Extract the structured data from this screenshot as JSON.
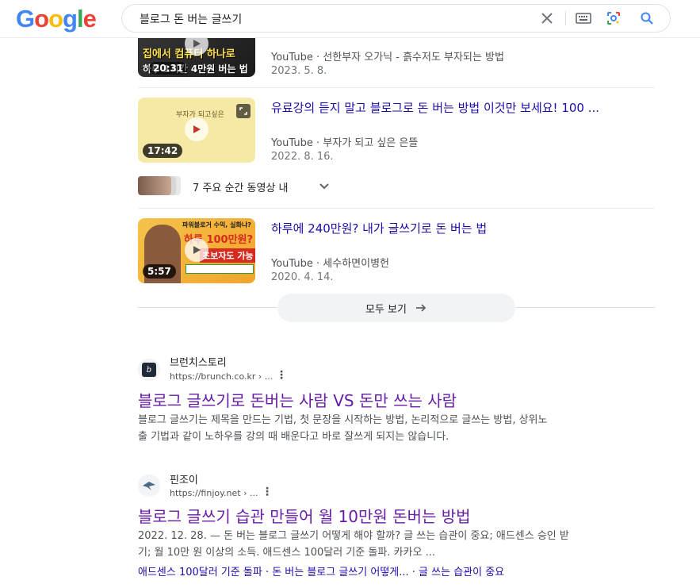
{
  "header": {
    "query": "블로그 돈 버는 글쓰기",
    "logo_letters": [
      {
        "ch": "G",
        "color": "#4285F4"
      },
      {
        "ch": "o",
        "color": "#EA4335"
      },
      {
        "ch": "o",
        "color": "#FBBC05"
      },
      {
        "ch": "g",
        "color": "#4285F4"
      },
      {
        "ch": "l",
        "color": "#34A853"
      },
      {
        "ch": "e",
        "color": "#EA4335"
      }
    ]
  },
  "videos": [
    {
      "title": "",
      "source": "YouTube",
      "channel": "선한부자 오가닉 - 흙수저도 부자되는 방법",
      "date": "2023. 5. 8.",
      "thumb_text_top": "집에서 컴퓨터 하나로",
      "thumb_text_bottom": "하루 1시간 4만원 버는 법",
      "duration": "20:31"
    },
    {
      "title": "유료강의 듣지 말고 블로그로 돈 버는 방법 이것만 보세요! 100 ...",
      "source": "YouTube",
      "channel": "부자가 되고 싶은 은뜰",
      "date": "2022. 8. 16.",
      "thumb_text": "부자가 되고싶은",
      "duration": "17:42"
    },
    {
      "title": "하루에 240만원? 내가 글쓰기로 돈 버는 법",
      "source": "YouTube",
      "channel": "세수하면이병헌",
      "date": "2020. 4. 14.",
      "thumb_text_top": "파워블로거 수익, 실화냐?",
      "thumb_text_mid": "하루 100만원?",
      "thumb_text_bottom": "초보자도 가능",
      "duration": "5:57"
    }
  ],
  "moments_label": "7 주요 순간 동영상 내",
  "see_all_label": "모두 보기",
  "results": [
    {
      "site": "브런치스토리",
      "url": "https://brunch.co.kr › ...",
      "title": "블로그 글쓰기로 돈버는 사람 VS 돈만 쓰는 사람",
      "snippet_line1": "블로그 글쓰기는 제목을 만드는 기법, 첫 문장을 시작하는 방법, 논리적으로 글쓰는 방법, 상위노",
      "snippet_line2": "출 기법과 같이 노하우를 강의 때 배운다고 바로 잘쓰게 되지는 않습니다."
    },
    {
      "site": "핀조이",
      "url": "https://finjoy.net › ...",
      "title": "블로그 글쓰기 습관 만들어 월 10만원 돈버는 방법",
      "snippet_line1": "2022. 12. 28. — 돈 버는 블로그 글쓰기 어떻게 해야 할까? 글 쓰는 습관이 중요; 애드센스 승인 받",
      "snippet_line2": "기; 월 10만 원 이상의 소득. 애드센스 100달러 기준 돌파. 카카오 ...",
      "sitelinks": "애드센스 100달러 기준 돌파 · 돈 버는 블로그 글쓰기 어떻게... · 글 쓰는 습관이 중요"
    }
  ]
}
